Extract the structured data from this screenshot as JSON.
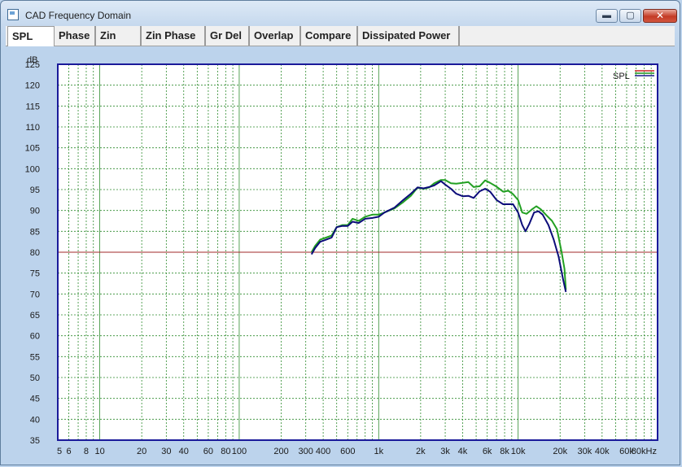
{
  "window": {
    "title": "CAD Frequency Domain",
    "buttons": {
      "minimize": "▬",
      "maximize": "▢",
      "close": "✕"
    }
  },
  "tabs": [
    {
      "label": "SPL",
      "active": true
    },
    {
      "label": "Phase",
      "active": false
    },
    {
      "label": "Zin",
      "active": false
    },
    {
      "label": "Zin Phase",
      "active": false
    },
    {
      "label": "Gr Del",
      "active": false
    },
    {
      "label": "Overlap",
      "active": false
    },
    {
      "label": "Compare",
      "active": false
    },
    {
      "label": "Dissipated Power",
      "active": false
    }
  ],
  "chart_data": {
    "type": "line",
    "ylabel": "dB",
    "ylim": [
      35,
      125
    ],
    "xlim": [
      5,
      100000
    ],
    "x_scale": "log",
    "y_tick_labels": [
      "125",
      "120",
      "115",
      "110",
      "105",
      "100",
      "95",
      "90",
      "85",
      "80",
      "75",
      "70",
      "65",
      "60",
      "55",
      "50",
      "45",
      "40",
      "35"
    ],
    "x_tick_labels": [
      {
        "f": 5,
        "label": "5"
      },
      {
        "f": 6,
        "label": "6"
      },
      {
        "f": 8,
        "label": "8"
      },
      {
        "f": 10,
        "label": "10"
      },
      {
        "f": 20,
        "label": "20"
      },
      {
        "f": 30,
        "label": "30"
      },
      {
        "f": 40,
        "label": "40"
      },
      {
        "f": 60,
        "label": "60"
      },
      {
        "f": 80,
        "label": "80"
      },
      {
        "f": 100,
        "label": "100"
      },
      {
        "f": 200,
        "label": "200"
      },
      {
        "f": 300,
        "label": "300"
      },
      {
        "f": 400,
        "label": "400"
      },
      {
        "f": 600,
        "label": "600"
      },
      {
        "f": 1000,
        "label": "1k"
      },
      {
        "f": 2000,
        "label": "2k"
      },
      {
        "f": 3000,
        "label": "3k"
      },
      {
        "f": 4000,
        "label": "4k"
      },
      {
        "f": 6000,
        "label": "6k"
      },
      {
        "f": 8000,
        "label": "8k"
      },
      {
        "f": 10000,
        "label": "10k"
      },
      {
        "f": 20000,
        "label": "20k"
      },
      {
        "f": 30000,
        "label": "30k"
      },
      {
        "f": 40000,
        "label": "40k"
      },
      {
        "f": 60000,
        "label": "60k"
      },
      {
        "f": 80000,
        "label": "80kHz"
      }
    ],
    "grid": true,
    "reference_line": {
      "value": 80,
      "color": "#a0282a"
    },
    "legend": {
      "position": "top-right",
      "label": "SPL",
      "colors": [
        "#cc2222",
        "#1a8f1a",
        "#1a1a8c"
      ]
    },
    "colors": {
      "background": "#ffffff",
      "grid": "#2e8b2e",
      "frame": "#1a1a9a"
    },
    "series": [
      {
        "color": "#22a022",
        "points": [
          [
            330,
            80
          ],
          [
            350,
            81.5
          ],
          [
            380,
            83
          ],
          [
            420,
            83.5
          ],
          [
            460,
            84
          ],
          [
            500,
            86
          ],
          [
            550,
            86.5
          ],
          [
            600,
            86.5
          ],
          [
            650,
            88
          ],
          [
            720,
            87.5
          ],
          [
            800,
            88.5
          ],
          [
            900,
            89
          ],
          [
            1000,
            89
          ],
          [
            1100,
            89.5
          ],
          [
            1300,
            90.5
          ],
          [
            1500,
            92
          ],
          [
            1700,
            93.5
          ],
          [
            1900,
            95.5
          ],
          [
            2100,
            95.2
          ],
          [
            2300,
            95.5
          ],
          [
            2500,
            96.5
          ],
          [
            2800,
            97.3
          ],
          [
            3000,
            97.3
          ],
          [
            3300,
            96.5
          ],
          [
            3600,
            96.4
          ],
          [
            4000,
            96.6
          ],
          [
            4400,
            96.8
          ],
          [
            4800,
            95.6
          ],
          [
            5300,
            95.8
          ],
          [
            5800,
            97.2
          ],
          [
            6300,
            96.6
          ],
          [
            7000,
            95.7
          ],
          [
            7800,
            94.5
          ],
          [
            8500,
            94.7
          ],
          [
            9200,
            93.9
          ],
          [
            10000,
            92.5
          ],
          [
            10700,
            89.5
          ],
          [
            11500,
            89.2
          ],
          [
            12500,
            90.2
          ],
          [
            13500,
            91
          ],
          [
            14500,
            90.3
          ],
          [
            16000,
            88.8
          ],
          [
            17500,
            87.5
          ],
          [
            19000,
            85.5
          ],
          [
            20500,
            80
          ],
          [
            21500,
            76
          ],
          [
            22000,
            71
          ]
        ]
      },
      {
        "color": "#0c0c7a",
        "points": [
          [
            330,
            79.5
          ],
          [
            350,
            81
          ],
          [
            380,
            82.5
          ],
          [
            420,
            83
          ],
          [
            460,
            83.5
          ],
          [
            500,
            86
          ],
          [
            550,
            86.3
          ],
          [
            600,
            86.3
          ],
          [
            650,
            87.3
          ],
          [
            720,
            87
          ],
          [
            800,
            88
          ],
          [
            900,
            88.2
          ],
          [
            1000,
            88.5
          ],
          [
            1100,
            89.5
          ],
          [
            1300,
            90.7
          ],
          [
            1500,
            92.5
          ],
          [
            1700,
            94
          ],
          [
            1900,
            95.5
          ],
          [
            2100,
            95.3
          ],
          [
            2300,
            95.6
          ],
          [
            2500,
            96
          ],
          [
            2800,
            97
          ],
          [
            3000,
            96.2
          ],
          [
            3300,
            95.2
          ],
          [
            3600,
            94
          ],
          [
            4000,
            93.4
          ],
          [
            4400,
            93.5
          ],
          [
            4800,
            93
          ],
          [
            5300,
            94.6
          ],
          [
            5800,
            95.2
          ],
          [
            6300,
            94.5
          ],
          [
            7000,
            92.5
          ],
          [
            7800,
            91.5
          ],
          [
            8500,
            91.5
          ],
          [
            9200,
            91.5
          ],
          [
            10000,
            89.5
          ],
          [
            10700,
            86.5
          ],
          [
            11300,
            85
          ],
          [
            12000,
            86.7
          ],
          [
            13000,
            89.5
          ],
          [
            14000,
            89.8
          ],
          [
            15000,
            89
          ],
          [
            16500,
            86.5
          ],
          [
            18000,
            83
          ],
          [
            19500,
            79
          ],
          [
            21000,
            73.5
          ],
          [
            22000,
            70.5
          ]
        ]
      }
    ]
  }
}
